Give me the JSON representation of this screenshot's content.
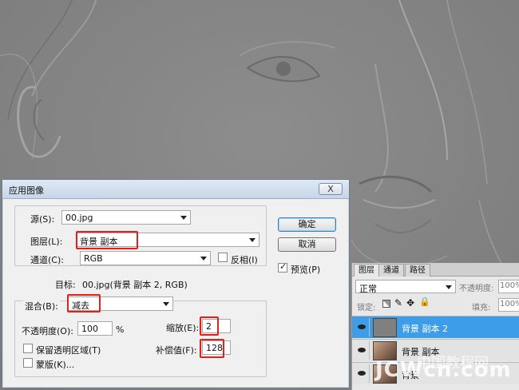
{
  "dialog": {
    "title": "应用图像",
    "close_label": "X",
    "source_label": "源(S):",
    "source_value": "00.jpg",
    "layer_label": "图层(L):",
    "layer_value": "背景 副本",
    "channel_label": "通道(C):",
    "channel_value": "RGB",
    "invert_label": "反相(I)",
    "target_label": "目标:",
    "target_value": "00.jpg(背景 副本 2, RGB)",
    "blending_label": "混合(B):",
    "blending_value": "减去",
    "opacity_label": "不透明度(O):",
    "opacity_value": "100",
    "opacity_unit": "%",
    "scale_label": "缩放(E):",
    "scale_value": "2",
    "offset_label": "补偿值(F):",
    "offset_value": "128",
    "preserve_label": "保留透明区域(T)",
    "mask_label": "蒙版(K)...",
    "ok_label": "确定",
    "cancel_label": "取消",
    "preview_label": "预览(P)",
    "preview_checked": true
  },
  "layers_panel": {
    "tabs": [
      "图层",
      "通道",
      "路径"
    ],
    "blend_mode": "正常",
    "opacity_label": "不透明度:",
    "opacity_value": "100%",
    "lock_label": "锁定:",
    "fill_label": "填充:",
    "fill_value": "100%",
    "layers": [
      {
        "name": "背景 副本 2",
        "selected": true
      },
      {
        "name": "背景 副本",
        "selected": false
      },
      {
        "name": "背景",
        "selected": false
      }
    ]
  },
  "watermark": {
    "text": "JCWcn.com",
    "cn": "中国教程网"
  },
  "colors": {
    "highlight": "#e0201a",
    "selected_layer": "#3d9de8"
  }
}
